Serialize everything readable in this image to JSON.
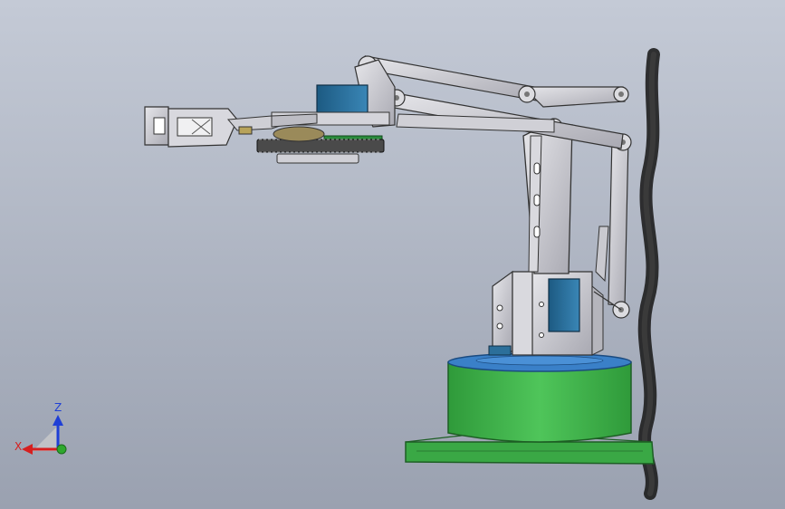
{
  "viewport": {
    "background_top": "#c2c8d4",
    "background_bottom": "#9aa1b0"
  },
  "triad": {
    "x_label": "X",
    "z_label": "Z",
    "x_color": "#d61f1f",
    "y_color": "#2ea82e",
    "z_color": "#1f3fd6"
  },
  "model": {
    "metal_color": "#c9c9cf",
    "servo_color": "#2c6f9a",
    "base_green": "#44b44e",
    "base_top_blue": "#3a80c8",
    "gear_color": "#4a4a4a",
    "cable_color": "#1e1e1e"
  }
}
